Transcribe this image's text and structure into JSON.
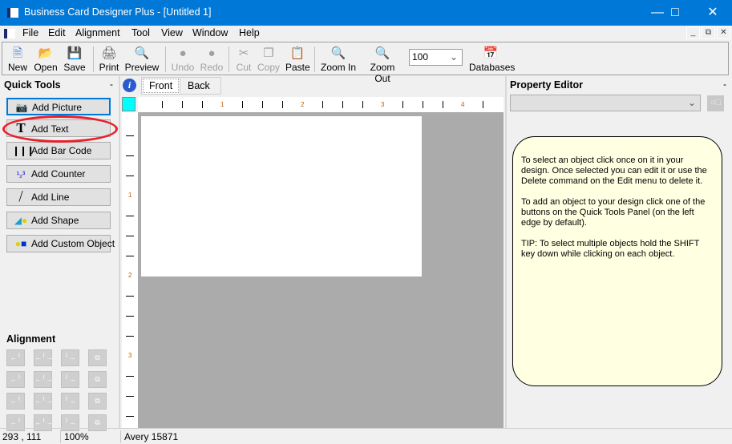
{
  "window": {
    "title": "Business Card Designer Plus  - [Untitled 1]",
    "controls": [
      "minimize",
      "maximize",
      "close"
    ]
  },
  "menu": [
    "File",
    "Edit",
    "Alignment",
    "Tool",
    "View",
    "Window",
    "Help"
  ],
  "toolbar": {
    "buttons": [
      {
        "label": "New",
        "icon": "new-document-icon",
        "enabled": true
      },
      {
        "label": "Open",
        "icon": "open-folder-icon",
        "enabled": true
      },
      {
        "label": "Save",
        "icon": "floppy-disk-icon",
        "enabled": true
      },
      {
        "label": "Print",
        "icon": "printer-icon",
        "enabled": true
      },
      {
        "label": "Preview",
        "icon": "print-preview-icon",
        "enabled": true
      },
      {
        "label": "Undo",
        "icon": "undo-icon",
        "enabled": false
      },
      {
        "label": "Redo",
        "icon": "redo-icon",
        "enabled": false
      },
      {
        "label": "Cut",
        "icon": "scissors-icon",
        "enabled": false
      },
      {
        "label": "Copy",
        "icon": "copy-icon",
        "enabled": false
      },
      {
        "label": "Paste",
        "icon": "clipboard-icon",
        "enabled": true
      },
      {
        "label": "Zoom In",
        "icon": "zoom-in-icon",
        "enabled": true
      },
      {
        "label": "Zoom Out",
        "icon": "zoom-out-icon",
        "enabled": true
      },
      {
        "label": "Databases",
        "icon": "database-icon",
        "enabled": true
      }
    ],
    "zoom_value": "100"
  },
  "quick_tools": {
    "title": "Quick Tools",
    "collapse": "-",
    "buttons": [
      {
        "label": "Add Picture",
        "icon": "camera-icon"
      },
      {
        "label": "Add Text",
        "icon": "text-t-icon"
      },
      {
        "label": "Add Bar Code",
        "icon": "barcode-icon"
      },
      {
        "label": "Add Counter",
        "icon": "counter-123-icon"
      },
      {
        "label": "Add Line",
        "icon": "line-icon"
      },
      {
        "label": "Add Shape",
        "icon": "shape-icon"
      },
      {
        "label": "Add Custom Object",
        "icon": "custom-object-icon"
      }
    ],
    "highlighted": "Add Text",
    "highlight_color": "#e8202a"
  },
  "alignment": {
    "title": "Alignment",
    "buttons_enabled": false
  },
  "design": {
    "tabs": [
      "Front",
      "Back"
    ],
    "active_tab": "Front",
    "ruler_top_labels": [
      "1",
      "2",
      "3",
      "4"
    ],
    "ruler_left_labels": [
      "1",
      "2",
      "3"
    ]
  },
  "property_editor": {
    "title": "Property Editor",
    "collapse": "-",
    "object_select": "",
    "help": [
      "To select an object click once on it in your design. Once selected you can edit it or use the Delete command on the Edit menu to delete it.",
      "To add an object to your design click one of the buttons on the Quick Tools Panel (on the left edge by default).",
      "TIP: To select multiple objects hold the SHIFT key down while clicking on each object."
    ]
  },
  "status": {
    "coords": "293 , 111",
    "zoom": "100%",
    "card_type": "Avery 15871"
  },
  "colors": {
    "titlebar": "#0078d7",
    "help_bg": "#ffffe1",
    "canvas_bg": "#ababab"
  }
}
